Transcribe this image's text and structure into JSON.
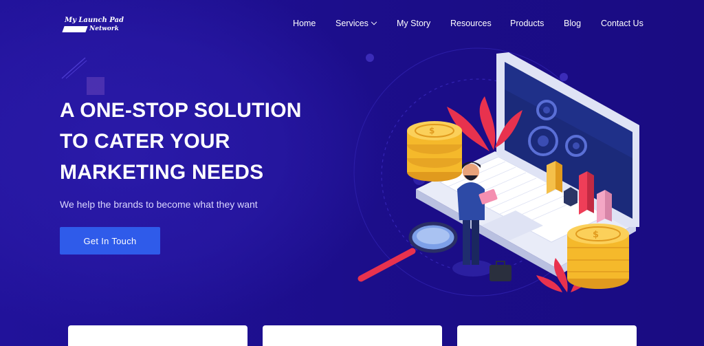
{
  "logo": {
    "line1": "My Launch Pad",
    "line2": "Network"
  },
  "nav": {
    "items": [
      {
        "label": "Home"
      },
      {
        "label": "Services"
      },
      {
        "label": "My Story"
      },
      {
        "label": "Resources"
      },
      {
        "label": "Products"
      },
      {
        "label": "Blog"
      },
      {
        "label": "Contact Us"
      }
    ]
  },
  "hero": {
    "headline": [
      "A ONE-STOP SOLUTION",
      "TO CATER YOUR",
      "MARKETING NEEDS"
    ],
    "subtitle": "We help the brands to become what they want",
    "cta_label": "Get In Touch"
  },
  "colors": {
    "background": "#1e0f8f",
    "cta": "#2f5bea",
    "coin": "#f5b92b",
    "accent_red": "#e8324e"
  },
  "illustration": {
    "name": "laptop-marketing-illustration"
  },
  "cards": [
    {},
    {},
    {}
  ]
}
